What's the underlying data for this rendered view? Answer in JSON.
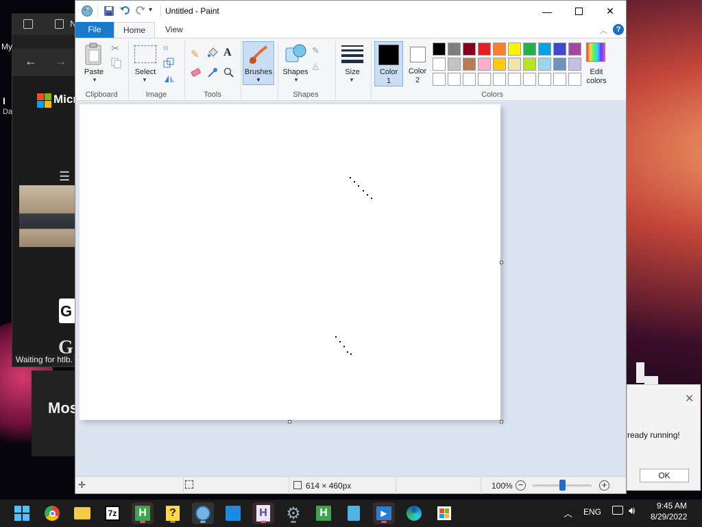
{
  "background": {
    "browser_tab_letter": "N",
    "browser_side_text_1": "My",
    "browser_side_text_2": "Da",
    "browser_brand": "Micr",
    "browser_status": "Waiting for htlb.",
    "browser_letter_g": "G",
    "browser_text_mos": "Mos",
    "notification_text": "ready running!",
    "notification_ok": "OK"
  },
  "paint": {
    "title": "Untitled - Paint",
    "tabs": {
      "file": "File",
      "home": "Home",
      "view": "View"
    },
    "ribbon": {
      "paste": "Paste",
      "select": "Select",
      "brushes": "Brushes",
      "shapes": "Shapes",
      "size": "Size",
      "color1": "Color 1",
      "color1_l1": "Color",
      "color1_l2": "1",
      "color2_l1": "Color",
      "color2_l2": "2",
      "edit_colors_l1": "Edit",
      "edit_colors_l2": "colors",
      "groups": {
        "clipboard": "Clipboard",
        "image": "Image",
        "tools": "Tools",
        "shapes": "Shapes",
        "colors": "Colors"
      }
    },
    "palette_row1": [
      "#000000",
      "#7f7f7f",
      "#880015",
      "#ed1c24",
      "#ff7f27",
      "#fff200",
      "#22b14c",
      "#00a2e8",
      "#3f48cc",
      "#a349a4"
    ],
    "palette_row2": [
      "#ffffff",
      "#c3c3c3",
      "#b97a57",
      "#ffaec9",
      "#ffc90e",
      "#efe4b0",
      "#b5e61d",
      "#99d9ea",
      "#7092be",
      "#c8bfe7"
    ],
    "palette_row3": [
      "#ffffff",
      "#ffffff",
      "#ffffff",
      "#ffffff",
      "#ffffff",
      "#ffffff",
      "#ffffff",
      "#ffffff",
      "#ffffff",
      "#ffffff"
    ],
    "color1_value": "#000000",
    "color2_value": "#ffffff",
    "status": {
      "image_size": "614 × 460px",
      "zoom": "100%",
      "zoom_fraction": 0.5
    }
  },
  "taskbar": {
    "time": "9:45 AM",
    "date": "8/29/2022",
    "language": "ENG"
  }
}
